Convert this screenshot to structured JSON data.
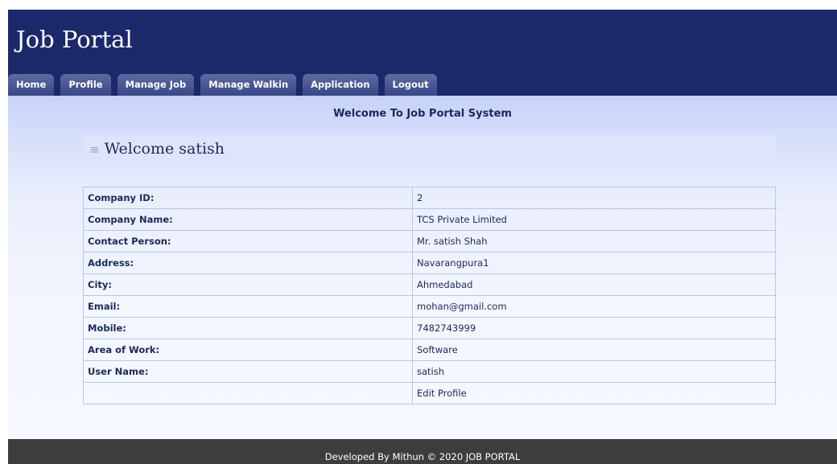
{
  "header": {
    "title": "Job Portal",
    "nav": [
      "Home",
      "Profile",
      "Manage Job",
      "Manage Walkin",
      "Application",
      "Logout"
    ]
  },
  "main": {
    "banner": "Welcome To Job Portal System",
    "heading": "Welcome satish",
    "profile": [
      {
        "label": "Company ID:",
        "value": "2"
      },
      {
        "label": "Company Name:",
        "value": "TCS Private Limited"
      },
      {
        "label": "Contact Person:",
        "value": "Mr. satish Shah"
      },
      {
        "label": "Address:",
        "value": "Navarangpura1"
      },
      {
        "label": "City:",
        "value": "Ahmedabad"
      },
      {
        "label": "Email:",
        "value": "mohan@gmail.com"
      },
      {
        "label": "Mobile:",
        "value": "7482743999"
      },
      {
        "label": "Area of Work:",
        "value": "Software"
      },
      {
        "label": "User Name:",
        "value": "satish"
      }
    ],
    "edit_label": "Edit Profile"
  },
  "footer": {
    "text": "Developed By Mithun © 2020 JOB PORTAL"
  },
  "colors": {
    "header_bg": "#1b296b",
    "footer_bg": "#3d3d3d",
    "table_border": "#b8c6ec"
  }
}
